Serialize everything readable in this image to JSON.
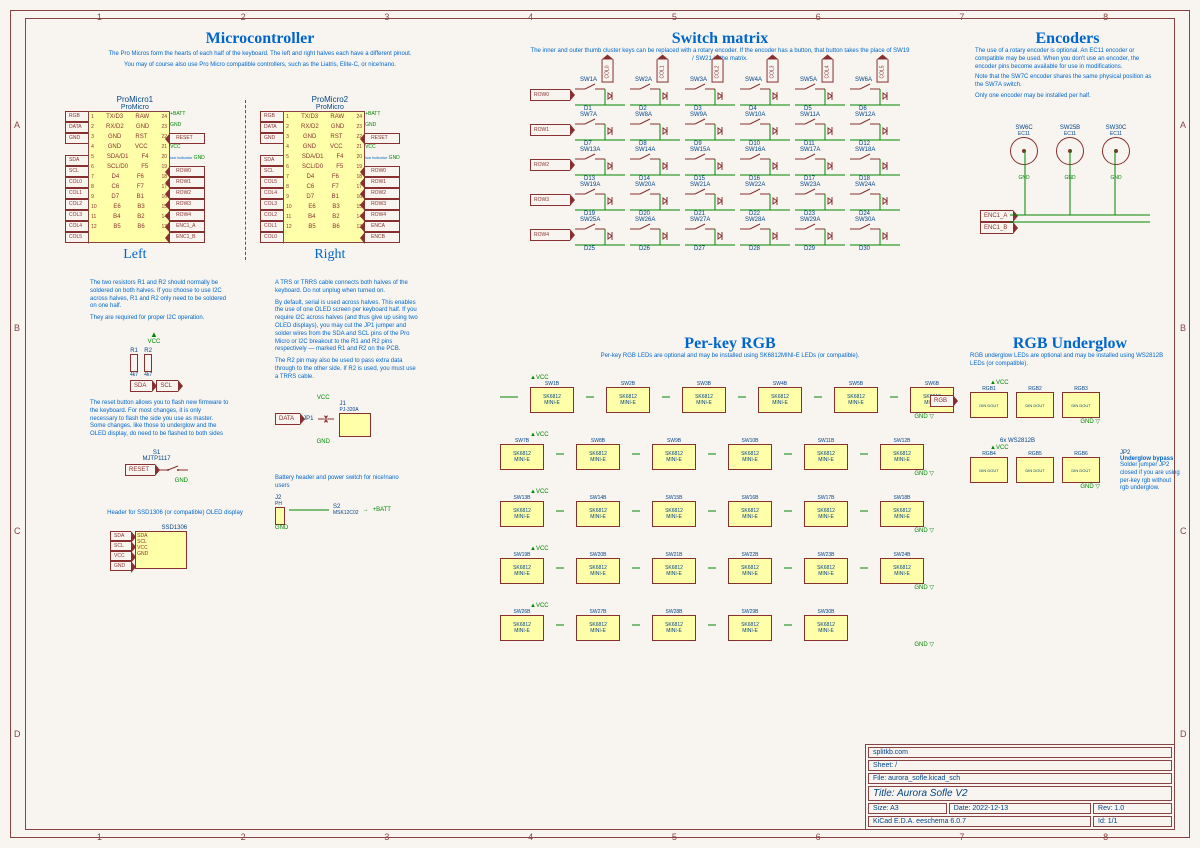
{
  "sections": {
    "mcu": {
      "title": "Microcontroller",
      "desc1": "The Pro Micros form the hearts of each half of the keyboard. The left and right halves each have a different pinout.",
      "desc2": "You may of course also use Pro Micro compatible controllers, such as the Liatris, Elite-C, or nice!nano.",
      "left_label": "Left",
      "right_label": "Right",
      "pm1_ref": "ProMicro1",
      "pm2_ref": "ProMicro2",
      "pm_name": "ProMicro",
      "left_pins_l": [
        "TX/D3",
        "RX/D2",
        "GND",
        "GND",
        "SDA/D1",
        "SCL/D0",
        "D4",
        "C6",
        "D7",
        "E6",
        "B4",
        "B5"
      ],
      "left_pins_r": [
        "RAW",
        "GND",
        "RST",
        "VCC",
        "F4",
        "F5",
        "F6",
        "F7",
        "B1",
        "B3",
        "B2",
        "B6"
      ],
      "left_nums_l": [
        "1",
        "2",
        "3",
        "4",
        "5",
        "6",
        "7",
        "8",
        "9",
        "10",
        "11",
        "12"
      ],
      "left_nums_r": [
        "24",
        "23",
        "22",
        "21",
        "20",
        "19",
        "18",
        "17",
        "16",
        "15",
        "14",
        "13"
      ],
      "left_ext_l": [
        "RGB",
        "DATA",
        "GND",
        "",
        "SDA",
        "SCL",
        "COL0",
        "COL1",
        "COL2",
        "COL3",
        "COL4",
        "COL5"
      ],
      "left_ext_r": [
        "+BATT",
        "GND",
        "RESET",
        "VCC",
        "GND",
        "ROW0",
        "ROW1",
        "ROW2",
        "ROW3",
        "ROW4",
        "ENC1_A",
        "ENC1_B"
      ],
      "right_ext_l": [
        "RGB",
        "DATA",
        "GND",
        "",
        "SDA",
        "SCL",
        "COL5",
        "COL4",
        "COL3",
        "COL2",
        "COL1",
        "COL0"
      ],
      "right_ext_r": [
        "+BATT",
        "GND",
        "RESET",
        "VCC",
        "GND",
        "ROW0",
        "ROW1",
        "ROW2",
        "ROW3",
        "ROW4",
        "ENCA",
        "ENCB"
      ],
      "indicator": "low indicator"
    },
    "resistors": {
      "desc": "The two resistors R1 and R2 should normally be soldered on both halves. If you choose to use I2C across halves, R1 and R2 only need to be soldered on one half.",
      "desc2": "They are required for proper I2C operation.",
      "r1": "R1",
      "r2": "R2",
      "val": "4k7",
      "nets": [
        "SDA",
        "SCL"
      ],
      "vcc": "VCC"
    },
    "reset": {
      "desc": "The reset button allows you to flash new firmware to the keyboard. For most changes, it is only necessary to flash the side you use as master. Some changes, like those to underglow and the OLED display, do need to be flashed to both sides",
      "ref": "S1",
      "part": "MJTP1117",
      "net": "RESET",
      "gnd": "GND"
    },
    "oled": {
      "desc": "Header for SSD1306 (or compatible) OLED display",
      "ref": "SSD1306",
      "pins": [
        "SDA",
        "SCL",
        "VCC",
        "GND"
      ]
    },
    "trrs": {
      "desc": "A TRS or TRRS cable connects both halves of the keyboard. Do not unplug when turned on.",
      "desc2": "By default, serial is used across halves. This enables the use of one OLED screen per keyboard half. If you require I2C across halves (and thus give up using two OLED displays), you may cut the JP1 jumper and solder wires from the SDA and SCL pins of the Pro Micro or I2C breakout to the R1 and R2 pins respectively — marked R1 and R2 on the PCB.",
      "desc3": "The R2 pin may also be used to pass extra data through to the other side. If R2 is used, you must use a TRRS cable.",
      "jp1": "JP1",
      "j1_ref": "J1",
      "j1_part": "PJ-320A",
      "net": "DATA",
      "vcc": "VCC",
      "gnd": "GND"
    },
    "battery": {
      "desc": "Battery header and power switch for nice!nano users",
      "j2": "J2",
      "j2_part": "PH",
      "s2": "S2",
      "s2_part": "MSK12C02",
      "gnd": "GND",
      "batt": "+BATT"
    },
    "matrix": {
      "title": "Switch matrix",
      "desc": "The inner and outer thumb cluster keys can be replaced with a rotary encoder. If the encoder has a button, that button takes the place of SW19 / SW21 in the matrix.",
      "cols": [
        "COL0",
        "COL1",
        "COL2",
        "COL3",
        "COL4",
        "COL5"
      ],
      "rows": [
        "ROW0",
        "ROW1",
        "ROW2",
        "ROW3",
        "ROW4"
      ],
      "sw_grid": [
        [
          "SW1A",
          "SW2A",
          "SW3A",
          "SW4A",
          "SW5A",
          "SW6A"
        ],
        [
          "SW7A",
          "SW8A",
          "SW9A",
          "SW10A",
          "SW11A",
          "SW12A"
        ],
        [
          "SW13A",
          "SW14A",
          "SW15A",
          "SW16A",
          "SW17A",
          "SW18A"
        ],
        [
          "SW19A",
          "SW20A",
          "SW21A",
          "SW22A",
          "SW23A",
          "SW24A"
        ],
        [
          "SW25A",
          "SW26A",
          "SW27A",
          "SW28A",
          "SW29A",
          "SW30A"
        ]
      ],
      "d_grid": [
        [
          "D1",
          "D2",
          "D3",
          "D4",
          "D5",
          "D6"
        ],
        [
          "D7",
          "D8",
          "D9",
          "D10",
          "D11",
          "D12"
        ],
        [
          "D13",
          "D14",
          "D15",
          "D16",
          "D17",
          "D18"
        ],
        [
          "D19",
          "D20",
          "D21",
          "D22",
          "D23",
          "D24"
        ],
        [
          "D25",
          "D26",
          "D27",
          "D28",
          "D29",
          "D30"
        ]
      ]
    },
    "encoders": {
      "title": "Encoders",
      "desc1": "The use of a rotary encoder is optional. An EC11 encoder or compatible may be used. When you don't use an encoder, the encoder pins become available for use in modifications.",
      "desc2": "Note that the SW7C encoder shares the same physical position as the SW7A switch.",
      "desc3": "Only one encoder may be installed per half.",
      "refs": [
        "SW6C",
        "SW25B",
        "SW30C"
      ],
      "part": "EC11",
      "nets": [
        "ENC1_A",
        "ENC1_B"
      ],
      "gnd": "GND"
    },
    "perkey": {
      "title": "Per-key RGB",
      "desc": "Per-key RGB LEDs are optional and may be installed using SK6812MINI-E LEDs (or compatible).",
      "rows_first": [
        "SW1B",
        "SW2B",
        "SW3B",
        "SW4B",
        "SW5B",
        "SW6B"
      ],
      "rows_other": [
        [
          "SW7B",
          "SW8B",
          "SW9B",
          "SW10B",
          "SW11B",
          "SW12B"
        ],
        [
          "SW13B",
          "SW14B",
          "SW15B",
          "SW16B",
          "SW17B",
          "SW18B"
        ],
        [
          "SW19B",
          "SW20B",
          "SW21B",
          "SW22B",
          "SW23B",
          "SW24B"
        ],
        [
          "SW26B",
          "SW27B",
          "SW28B",
          "SW29B",
          "SW30B"
        ]
      ],
      "ic": "SK6812",
      "ic2": "MINI-E",
      "vcc": "VCC",
      "gnd": "GND",
      "pins": [
        "DIN",
        "DOUT"
      ]
    },
    "underglow": {
      "title": "RGB Underglow",
      "desc": "RGB underglow LEDs are optional and may be installed using WS2812B LEDs (or compatible).",
      "net": "RGB",
      "top": [
        "RGB1",
        "RGB2",
        "RGB3"
      ],
      "bot": [
        "RGB4",
        "RGB5",
        "RGB6"
      ],
      "chain_label": "6x WS2812B",
      "pins": [
        "DIN",
        "DOUT"
      ],
      "vcc": "VCC",
      "gnd": "GND",
      "bypass_title": "Underglow bypass",
      "bypass_desc": "Solder jumper JP2 closed if you are using per-key rgb without rgb underglow.",
      "jp2": "JP2"
    }
  },
  "title_block": {
    "company": "splitkb.com",
    "sheet": "Sheet: /",
    "file": "File: aurora_sofle.kicad_sch",
    "title": "Title: Aurora Sofle V2",
    "size": "Size: A3",
    "date": "Date: 2022-12-13",
    "rev": "Rev: 1.0",
    "app": "KiCad E.D.A.  eeschema 6.0.7",
    "id": "Id: 1/1"
  },
  "ruler_h": [
    "1",
    "2",
    "3",
    "4",
    "5",
    "6",
    "7",
    "8"
  ],
  "ruler_v": [
    "A",
    "B",
    "C",
    "D"
  ]
}
